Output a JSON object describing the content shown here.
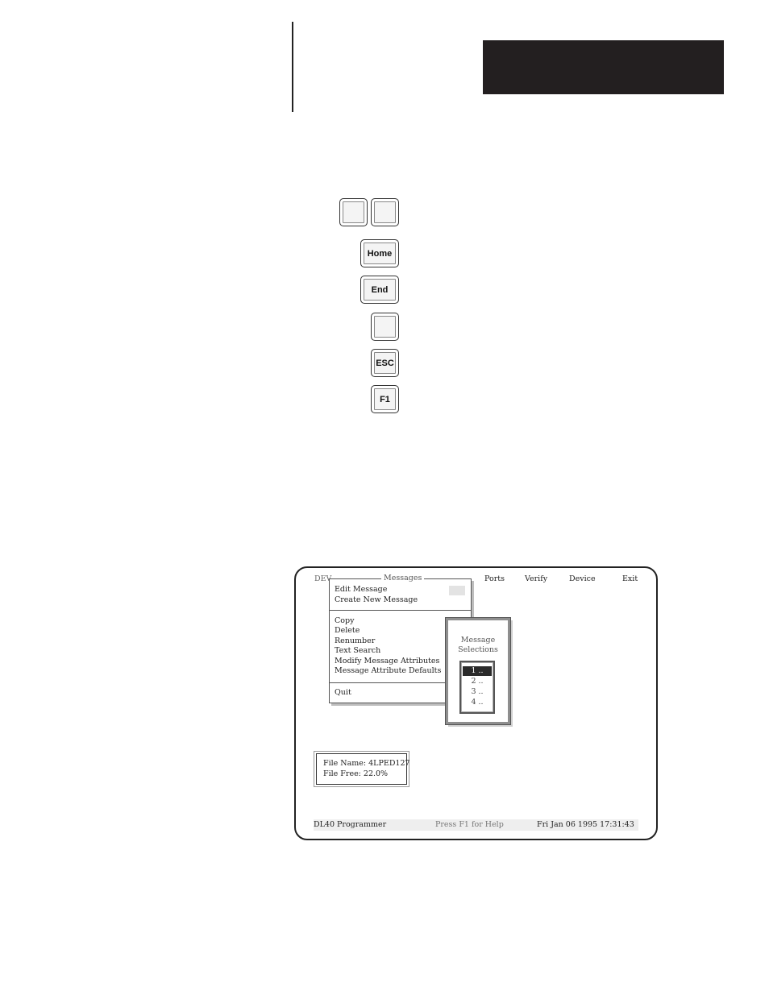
{
  "keys": [
    {
      "id": "arrow-left",
      "label": ""
    },
    {
      "id": "arrow-right",
      "label": ""
    },
    {
      "id": "home",
      "label": "Home"
    },
    {
      "id": "end",
      "label": "End"
    },
    {
      "id": "enter",
      "label": ""
    },
    {
      "id": "esc",
      "label": "ESC"
    },
    {
      "id": "f1",
      "label": "F1"
    }
  ],
  "screen": {
    "menubar": {
      "dev": "DEV",
      "messages": "Messages",
      "ports": "Ports",
      "verify": "Verify",
      "device": "Device",
      "exit": "Exit"
    },
    "messages_menu": {
      "items_top": [
        "Edit Message",
        "Create New Message"
      ],
      "items_mid": [
        "Copy",
        "Delete",
        "Renumber",
        "Text Search",
        "Modify Message Attributes",
        "Message Attribute Defaults"
      ],
      "items_bottom": [
        "Quit"
      ]
    },
    "selection_box": {
      "title_line1": "Message",
      "title_line2": "Selections",
      "items": [
        "1 ..",
        "2 ..",
        "3 ..",
        "4 .."
      ],
      "selected_index": 0
    },
    "file_info": {
      "name_line": "File Name: 4LPED127",
      "free_line": "File Free:  22.0%"
    },
    "status_bar": {
      "left": "DL40 Programmer",
      "center": "Press F1 for Help",
      "right": "Fri Jan 06 1995 17:31:43"
    }
  }
}
